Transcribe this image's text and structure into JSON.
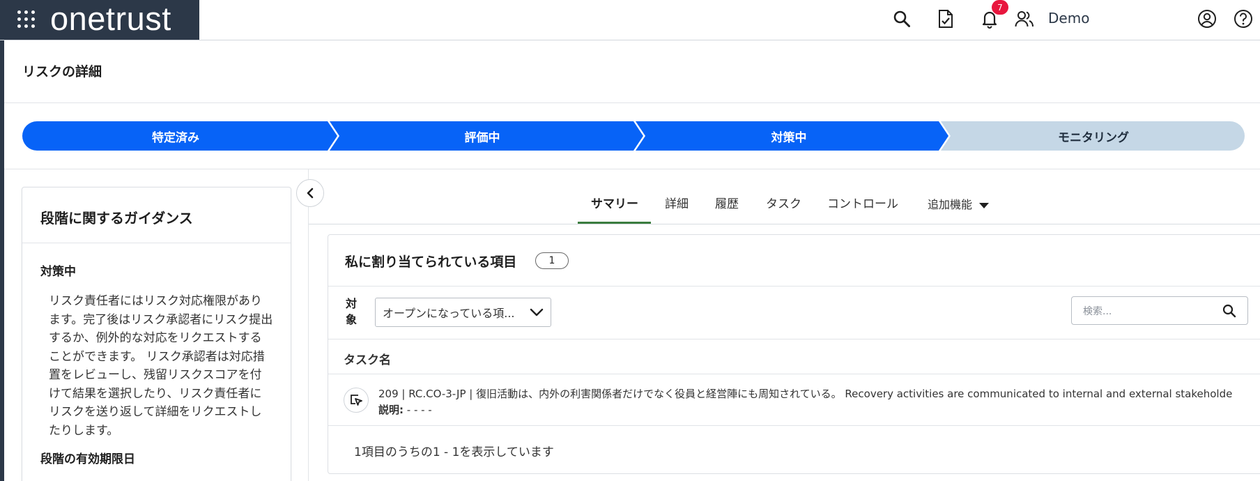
{
  "brand": {
    "logo_text": "onetrust",
    "color": "#2c3848"
  },
  "topbar": {
    "icons": [
      "search-icon",
      "document-check-icon",
      "bell-icon",
      "users-icon",
      "user-circle-icon",
      "help-icon"
    ],
    "notification_count": "7",
    "user_name": "Demo"
  },
  "page": {
    "title": "リスクの詳細"
  },
  "stepper": {
    "steps": [
      {
        "label": "特定済み",
        "state": "complete"
      },
      {
        "label": "評価中",
        "state": "complete"
      },
      {
        "label": "対策中",
        "state": "current"
      },
      {
        "label": "モニタリング",
        "state": "pending"
      }
    ],
    "active_color": "#0763f7",
    "pending_color": "#c5d7e6"
  },
  "guidance": {
    "title": "段階に関するガイダンス",
    "stage": "対策中",
    "text": "リスク責任者にはリスク対応権限があります。完了後はリスク承認者にリスク提出するか、例外的な対応をリクエストすることができます。 リスク承認者は対応措置をレビューし、残留リスクスコアを付けて結果を選択したり、リスク責任者にリスクを送り返して詳細をリクエストしたりします。",
    "expiry_label": "段階の有効期限日"
  },
  "tabs": {
    "items": [
      "サマリー",
      "詳細",
      "履歴",
      "タスク",
      "コントロール"
    ],
    "more": "追加機能",
    "active_index": 0
  },
  "assigned": {
    "title": "私に割り当てられている項目",
    "count": "1",
    "filter_label": "対象",
    "filter_value": "オープンになっている項...",
    "search_placeholder": "検索...",
    "column_header": "タスク名",
    "task": {
      "title": "209 | RC.CO-3-JP | 復旧活動は、内外の利害関係者だけでなく役員と経営陣にも周知されている。 Recovery activities are communicated to internal and external stakeholde",
      "desc_label": "説明:",
      "desc_value": " - - - -"
    },
    "pager": "1項目のうちの1 - 1を表示しています"
  }
}
